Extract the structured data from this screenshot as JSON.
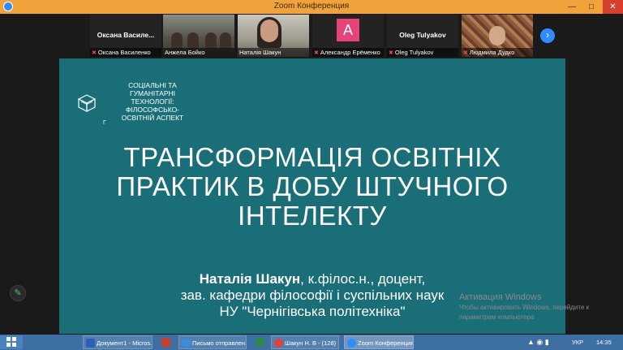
{
  "window": {
    "title": "Zoom Конференция"
  },
  "participants": [
    {
      "display": "Оксана  Василе...",
      "label": "Оксана Василенко",
      "muted": true
    },
    {
      "label": "Анжела Бойко",
      "muted": false
    },
    {
      "label": "Наталія Шакун",
      "muted": false
    },
    {
      "avatar_letter": "A",
      "label": "Александр Ерёменко",
      "muted": true
    },
    {
      "display": "Oleg Tulyakov",
      "label": "Oleg Tulyakov",
      "muted": true
    },
    {
      "label": "Людмила Дудко",
      "muted": true
    }
  ],
  "slide": {
    "org_line1": "СОЦІАЛЬНІ ТА",
    "org_line2": "ГУМАНІТАРНІ",
    "org_line3": "ТЕХНОЛОГІЇ:",
    "org_line4": "ФІЛОСОФСЬКО-",
    "org_line5": "ОСВІТНІЙ АСПЕКТ",
    "org_small": "Г",
    "headline_line1": "ТРАНСФОРМАЦІЯ ОСВІТНІХ",
    "headline_line2": "ПРАКТИК В ДОБУ ШТУЧНОГО",
    "headline_line3": "ІНТЕЛЕКТУ",
    "author_name": "Наталія Шакун",
    "author_rest": ", к.філос.н., доцент,",
    "author_line2": "зав. кафедри філософії і суспільних наук",
    "author_line3": "НУ \"Чернігівська політехніка\"",
    "bg_color": "#1a6e77"
  },
  "watermark": {
    "line1": "Активация Windows",
    "line2": "Чтобы активировать Windows, перейдите к",
    "line3": "параметрам компьютера"
  },
  "taskbar": {
    "items": [
      {
        "label": "Документ1 - Micros...",
        "icon_color": "#2b5fb8"
      },
      {
        "label": "",
        "icon_color": "#c7402e"
      },
      {
        "label": "Письмо отправлен...",
        "icon_color": "#3a8de0"
      },
      {
        "label": "",
        "icon_color": "#2b8a3e"
      },
      {
        "label": "Шакун Н. В - (128)",
        "icon_color": "#e04040"
      },
      {
        "label": "Zoom Конференция",
        "icon_color": "#2d8cff"
      }
    ],
    "lang": "УКР",
    "clock": "14:35"
  }
}
